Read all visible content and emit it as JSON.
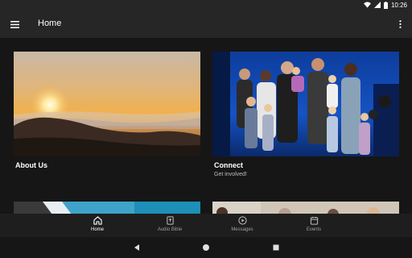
{
  "status_bar": {
    "time": "10:26"
  },
  "app_bar": {
    "title": "Home"
  },
  "cards": [
    {
      "title": "About Us",
      "subtitle": ""
    },
    {
      "title": "Connect",
      "subtitle": "Get involved!"
    }
  ],
  "bottom_nav": {
    "items": [
      {
        "label": "Home",
        "icon": "home-icon",
        "active": true
      },
      {
        "label": "Audio Bible",
        "icon": "bible-icon",
        "active": false
      },
      {
        "label": "Messages",
        "icon": "play-circle-icon",
        "active": false
      },
      {
        "label": "Events",
        "icon": "calendar-icon",
        "active": false
      }
    ]
  },
  "colors": {
    "background": "#161616",
    "app_bar": "#262626",
    "bottom_nav": "#1e1e1e"
  }
}
